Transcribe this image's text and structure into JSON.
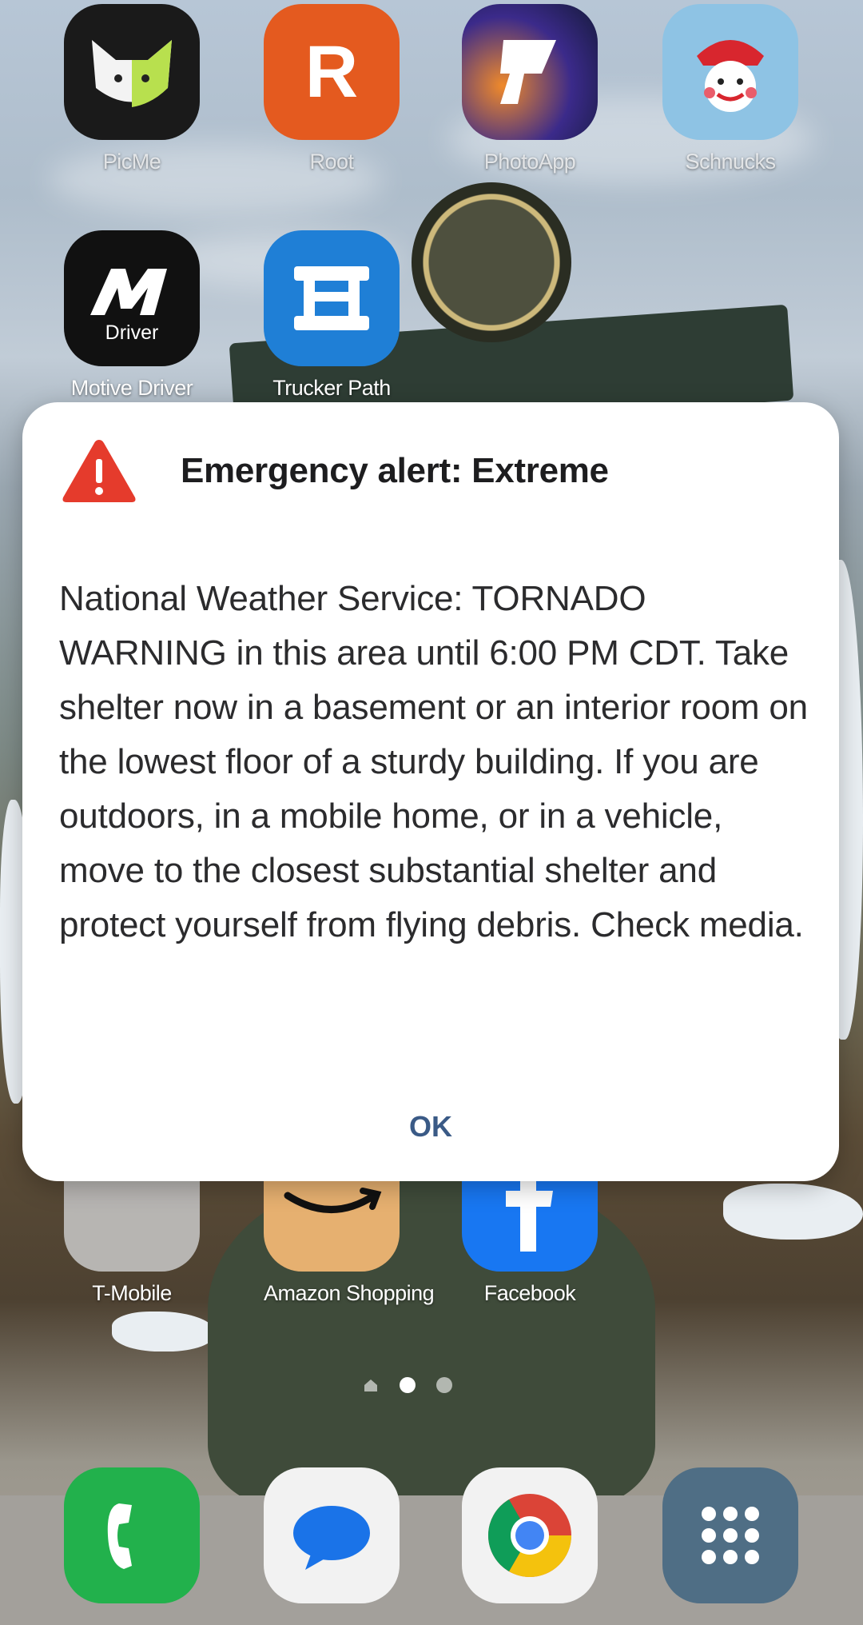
{
  "home": {
    "row1": [
      {
        "label": "PicMe"
      },
      {
        "label": "Root"
      },
      {
        "label": "PhotoApp"
      },
      {
        "label": "Schnucks"
      }
    ],
    "row2": [
      {
        "label": "Motive Driver",
        "icon_caption": "Driver"
      },
      {
        "label": "Trucker Path"
      }
    ],
    "row3": [
      {
        "label": "T-Mobile"
      },
      {
        "label": "Amazon Shopping"
      },
      {
        "label": "Facebook"
      }
    ],
    "root_letter": "R",
    "dock": [
      {
        "name": "phone-icon"
      },
      {
        "name": "messages-icon"
      },
      {
        "name": "chrome-icon"
      },
      {
        "name": "app-drawer-icon"
      }
    ]
  },
  "alert": {
    "title": "Emergency alert: Extreme",
    "body": "National Weather Service: TORNADO WARNING in this area until 6:00 PM CDT. Take shelter now in a basement or an interior room on the lowest floor of a sturdy building. If you are outdoors, in a mobile home, or in a vehicle, move to the closest substantial shelter and protect yourself from flying debris. Check media.",
    "ok_label": "OK",
    "warning_color": "#e53b2c",
    "ok_color": "#3a5a86"
  },
  "page_indicator": {
    "pages": 2,
    "active": 1
  }
}
